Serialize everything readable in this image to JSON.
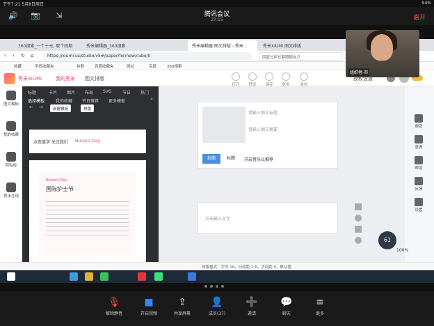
{
  "status_bar": {
    "left": "下午7:21  5月8日周日",
    "right": "94%"
  },
  "meeting": {
    "title": "腾讯会议",
    "time": "27:15",
    "leave": "离开",
    "self_name": "组织者-邓"
  },
  "browser": {
    "tabs": [
      "360搜索_一个十元, 取个四期",
      "秀米编辑器_360搜索",
      "秀米编辑器 图文排版 - 秀米...",
      "秀米XIUMI 图文排版"
    ],
    "url": "https://xiumi.us/studio/v5#/paper/for/new/cube/0",
    "search_placeholder": "回家过年长期照顾自己",
    "bookmarks": [
      "收藏",
      "手机收藏夹",
      "谷歌",
      "百度收藏夹",
      "网址",
      "百度",
      "360搜索"
    ]
  },
  "app": {
    "logo": "秀米XIUMI",
    "nav": [
      "我的秀米",
      "图文排版"
    ],
    "tools": [
      "打开",
      "预览",
      "保存",
      "更多",
      "发布"
    ],
    "user_label": "授权设置"
  },
  "left_rail": [
    "图文模板",
    "我的收藏",
    "剪贴板",
    "秀米在线"
  ],
  "categories_row1": [
    "标题",
    "卡片",
    "图片",
    "布局",
    "SVG",
    "节日",
    "热门"
  ],
  "categories_row2": [
    "选择模板",
    "我的收藏",
    "节日推荐",
    "更多模板"
  ],
  "template_buttons": [
    "新建模板",
    "排版"
  ],
  "templates": {
    "t1_title": "点击蓝字 关注我们",
    "t1_tag": "Nurse's Day",
    "t2_title": "国际护士节",
    "t2_sub": "Nurse's Day"
  },
  "canvas": {
    "title_placeholder": "请输入图文标题",
    "summary_placeholder": "请输入图文摘要",
    "tabs": [
      "封面",
      "标题"
    ],
    "check_label": "开启音乐以推荐",
    "text_placeholder": "点击输入文字"
  },
  "right_rail": [
    "撤销",
    "重做",
    "帮助",
    "反馈",
    "设置"
  ],
  "status_row": "排版格式：字号 16，行间距 1.6，字间距 0，默认值",
  "zoom": {
    "percent": "100%",
    "gauge": "61"
  },
  "meeting_bottom": [
    "解除静音",
    "开启视频",
    "共享屏幕",
    "成员(37)",
    "邀请",
    "聊天",
    "更多"
  ]
}
